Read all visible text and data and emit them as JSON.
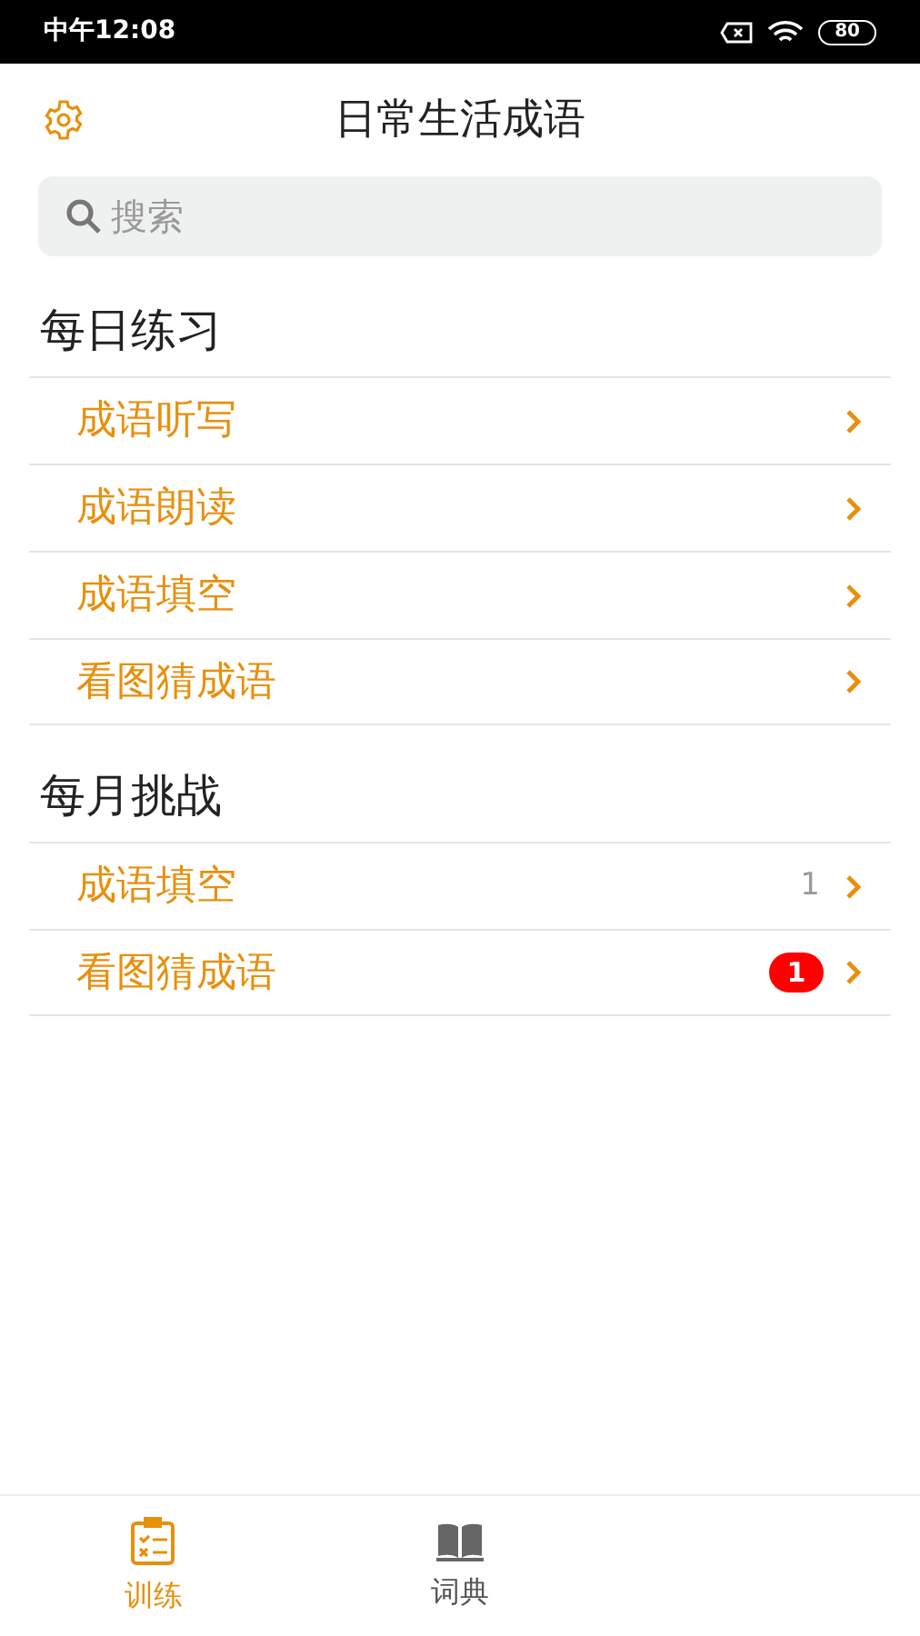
{
  "status_bar": {
    "time": "中午12:08",
    "battery": "80"
  },
  "header": {
    "title": "日常生活成语"
  },
  "search": {
    "placeholder": "搜索"
  },
  "sections": [
    {
      "title": "每日练习",
      "items": [
        {
          "label": "成语听写"
        },
        {
          "label": "成语朗读"
        },
        {
          "label": "成语填空"
        },
        {
          "label": "看图猜成语"
        }
      ]
    },
    {
      "title": "每月挑战",
      "items": [
        {
          "label": "成语填空",
          "count": "1",
          "kind": "plain"
        },
        {
          "label": "看图猜成语",
          "count": "1",
          "kind": "badge"
        }
      ]
    }
  ],
  "tabs": [
    {
      "label": "训练",
      "selected": true,
      "kind": "clipboard"
    },
    {
      "label": "词典",
      "selected": false,
      "kind": "book"
    }
  ]
}
